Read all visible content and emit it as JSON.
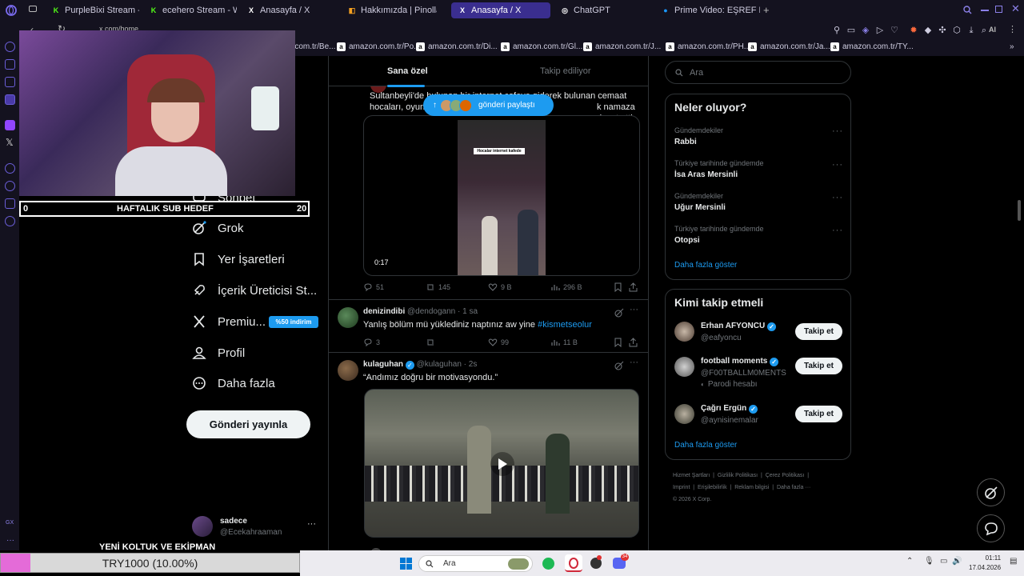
{
  "browser": {
    "tabs": [
      {
        "label": "PurpleBixi Stream - Watch",
        "icon": "kick-icon",
        "color": "#53fc18"
      },
      {
        "label": "ecehero Stream - Watch L",
        "icon": "kick-icon",
        "color": "#53fc18"
      },
      {
        "label": "Anasayfa / X",
        "icon": "x-icon",
        "color": "#ffffff"
      },
      {
        "label": "Hakkımızda | Pinolla.com",
        "icon": "pinolla-icon",
        "color": "#f4a020"
      },
      {
        "label": "Anasayfa / X",
        "icon": "x-icon",
        "color": "#ffffff"
      },
      {
        "label": "ChatGPT",
        "icon": "chatgpt-icon",
        "color": "#ffffff"
      },
      {
        "label": "Prime Video: EŞREF RÜYA",
        "icon": "prime-icon",
        "color": "#1a98ff"
      }
    ],
    "address": "x.com/home",
    "ai_label": "AI",
    "bookmarks": [
      "amazon.com.tr/Be...",
      "amazon.com.tr/Po...",
      "amazon.com.tr/Di...",
      "amazon.com.tr/Gl...",
      "amazon.com.tr/J...",
      "amazon.com.tr/PH...",
      "amazon.com.tr/Ja...",
      "amazon.com.tr/TY..."
    ],
    "bookmark_letter": "a"
  },
  "x_nav": {
    "items": [
      {
        "label": "Sohbet",
        "icon": "chat-icon"
      },
      {
        "label": "Grok",
        "icon": "grok-icon"
      },
      {
        "label": "Yer İşaretleri",
        "icon": "bookmark-icon"
      },
      {
        "label": "İçerik Üreticisi St...",
        "icon": "rocket-icon"
      },
      {
        "label": "Premiu...",
        "icon": "x-premium-icon"
      },
      {
        "label": "Profil",
        "icon": "person-icon"
      },
      {
        "label": "Daha fazla",
        "icon": "more-circle-icon"
      }
    ],
    "premium_badge": "%50 indirim",
    "post_button": "Gönderi yayınla",
    "account": {
      "name": "sadece",
      "handle": "@Ecekahraaman"
    }
  },
  "feed": {
    "tabs": [
      "Sana özel",
      "Takip ediliyor"
    ],
    "new_posts_pill": "gönderi paylaştı",
    "tweet1": {
      "text_line1": "Sultanbeyli'de bulunan bir internet cafeye giderek bulunan cemaat",
      "text_line2": "hocaları, oyun oynayan çocukları",
      "text_line2_end": "k namaza davet etti.",
      "video_caption": "Hocalar internet kafede",
      "duration": "0:17",
      "replies": "51",
      "reposts": "145",
      "likes": "9 B",
      "views": "296 B"
    },
    "tweet2": {
      "name": "denizindibi",
      "handle": "@dendogann",
      "time": "· 1 sa",
      "text": "Yanlış bölüm mü yüklediniz naptınız aw yine",
      "hashtag": "#kismetseolur",
      "replies": "3",
      "likes": "99",
      "views": "11 B"
    },
    "tweet3": {
      "name": "kulaguhan",
      "handle": "@kulaguhan",
      "time": "· 2s",
      "text": "“Andımız doğru bir motivasyondu.”"
    }
  },
  "right": {
    "search_placeholder": "Ara",
    "trends_title": "Neler oluyor?",
    "trends": [
      {
        "category": "Gündemdekiler",
        "name": "Rabbi"
      },
      {
        "category": "Türkiye tarihinde gündemde",
        "name": "İsa Aras Mersinli"
      },
      {
        "category": "Gündemdekiler",
        "name": "Uğur Mersinli"
      },
      {
        "category": "Türkiye tarihinde gündemde",
        "name": "Otopsi"
      }
    ],
    "show_more": "Daha fazla göster",
    "who_title": "Kimi takip etmeli",
    "who": [
      {
        "name": "Erhan AFYONCU",
        "handle": "@eafyoncu",
        "extra": ""
      },
      {
        "name": "football moments",
        "handle": "@F00TBALLM0MENTS",
        "extra": "Parodi hesabı"
      },
      {
        "name": "Çağrı Ergün",
        "handle": "@aynisinemalar",
        "extra": ""
      }
    ],
    "follow_label": "Takip et",
    "footer_line1": [
      "Hizmet Şartları",
      "Gizlilik Politikası",
      "Çerez Politikası"
    ],
    "footer_line2": [
      "Imprint",
      "Erişilebilirlik",
      "Reklam bilgisi",
      "Daha fazla ···"
    ],
    "copyright": "© 2026 X Corp."
  },
  "stream": {
    "sub_goal_start": "0",
    "sub_goal_label": "HAFTALIK SUB HEDEF",
    "sub_goal_end": "20",
    "subtitle": "YENİ KOLTUK VE EKİPMAN",
    "donation_text": "TRY1000 (10.00%)",
    "donation_progress": 0.1
  },
  "taskbar": {
    "search": "Ara",
    "time": "01:11",
    "date": "17.04.2026",
    "discord_badge": "34"
  }
}
